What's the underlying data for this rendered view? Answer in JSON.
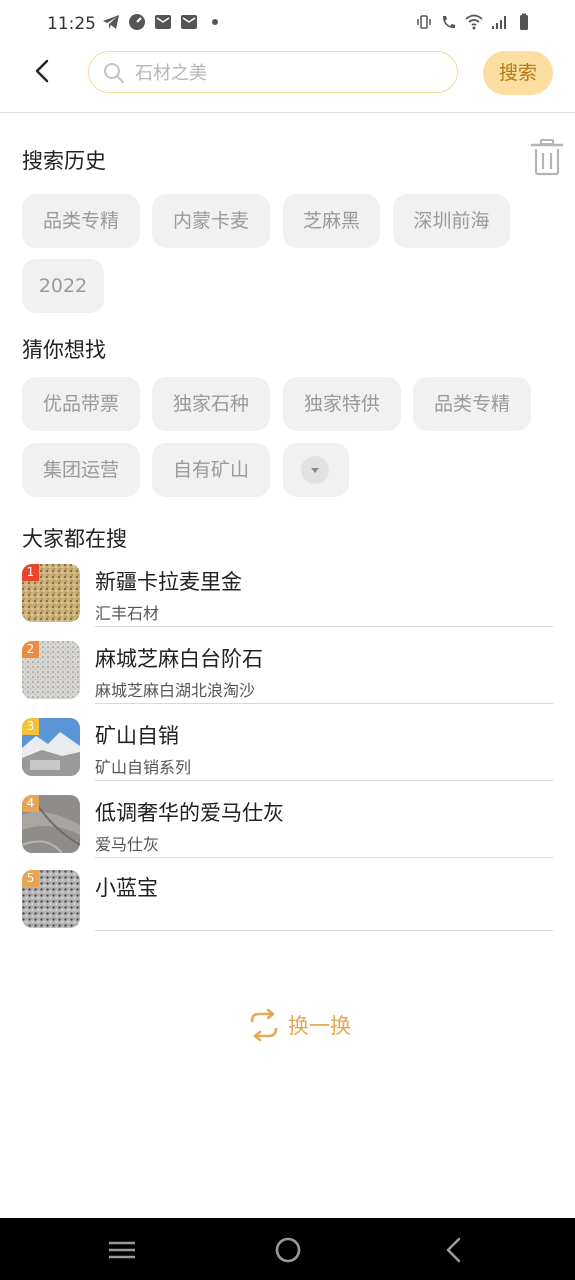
{
  "status": {
    "time": "11:25"
  },
  "header": {
    "search_placeholder": "石材之美",
    "search_button": "搜索"
  },
  "history": {
    "title": "搜索历史",
    "items": [
      "品类专精",
      "内蒙卡麦",
      "芝麻黑",
      "深圳前海",
      "2022"
    ]
  },
  "guess": {
    "title": "猜你想找",
    "items": [
      "优品带票",
      "独家石种",
      "独家特供",
      "品类专精",
      "集团运营",
      "自有矿山"
    ]
  },
  "hot": {
    "title": "大家都在搜",
    "items": [
      {
        "rank": "1",
        "title": "新疆卡拉麦里金",
        "subtitle": "汇丰石材",
        "rank_color": "#e8452c"
      },
      {
        "rank": "2",
        "title": "麻城芝麻白台阶石",
        "subtitle": "麻城芝麻白湖北浪淘沙",
        "rank_color": "#f08a3c"
      },
      {
        "rank": "3",
        "title": "矿山自销",
        "subtitle": "矿山自销系列",
        "rank_color": "#f3c23a"
      },
      {
        "rank": "4",
        "title": "低调奢华的爱马仕灰",
        "subtitle": "爱马仕灰",
        "rank_color": "#e6a455"
      },
      {
        "rank": "5",
        "title": "小蓝宝",
        "subtitle": "",
        "rank_color": "#e6a455"
      }
    ]
  },
  "refresh_label": "换一换",
  "colors": {
    "accent": "#fbdea0",
    "accent_text": "#b47a1c",
    "refresh": "#e2a957"
  }
}
